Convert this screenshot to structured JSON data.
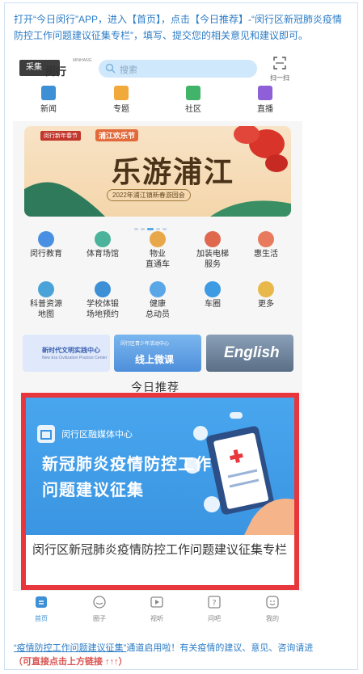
{
  "intro": "打开“今日闵行”APP，进入【首页】，点击【今日推荐】-“闵行区新冠肺炎疫情防控工作问题建议征集专栏”，填写、提交您的相关意见和建议即可。",
  "app": {
    "caiji": "采集",
    "brand": "闵行",
    "brand_small": "MINHANG",
    "search_placeholder": "搜索",
    "scan_label": "扫一扫",
    "nav": [
      {
        "label": "新闻",
        "color": "#3d8fd6"
      },
      {
        "label": "专题",
        "color": "#f2a93b"
      },
      {
        "label": "社区",
        "color": "#41b46a"
      },
      {
        "label": "直播",
        "color": "#8e5fd6"
      }
    ],
    "banner": {
      "title": "乐游浦江",
      "subtitle": "2022年浦江镇新春游园会",
      "tag1": "闵行新年春节",
      "tag2": "浦江欢乐节"
    },
    "grid": [
      {
        "label": "闵行教育",
        "color": "#4a90e2"
      },
      {
        "label": "体育场馆",
        "color": "#4bb39a"
      },
      {
        "label": "物业\n直通车",
        "color": "#e8a84a"
      },
      {
        "label": "加装电梯\n服务",
        "color": "#e0684f"
      },
      {
        "label": "惠生活",
        "color": "#e87b5e"
      },
      {
        "label": "科普资源\n地图",
        "color": "#4aa3d8"
      },
      {
        "label": "学校体锻\n场地预约",
        "color": "#3d8fd6"
      },
      {
        "label": "健康\n总动员",
        "color": "#5aa7e8"
      },
      {
        "label": "车圈",
        "color": "#3c9be2"
      },
      {
        "label": "更多",
        "color": "#e8b94a"
      }
    ],
    "promos": [
      {
        "text": "新时代文明实践中心",
        "sub": "New Era Civilization Practice Center"
      },
      {
        "text": "线上微课",
        "sub": "闵行区青少年活动中心"
      },
      {
        "text": "English",
        "sub": ""
      }
    ],
    "today_title": "今日推荐",
    "card": {
      "org": "闵行区融媒体中心",
      "line1": "新冠肺炎疫情防控工作",
      "line2": "问题建议征集",
      "title": "闵行区新冠肺炎疫情防控工作问题建议征集专栏"
    },
    "tabs": [
      {
        "label": "首页",
        "icon": "home-icon",
        "active": true
      },
      {
        "label": "圈子",
        "icon": "chat-bubble-icon",
        "active": false
      },
      {
        "label": "视听",
        "icon": "video-icon",
        "active": false
      },
      {
        "label": "问吧",
        "icon": "question-icon",
        "active": false
      },
      {
        "label": "我的",
        "icon": "smile-icon",
        "active": false
      }
    ]
  },
  "footer": {
    "link": "“疫情防控工作问题建议征集”",
    "rest": "通道启用啦！有关疫情的建议、意见、咨询请进",
    "note": "（可直接点击上方链接 ↑↑↑）"
  }
}
